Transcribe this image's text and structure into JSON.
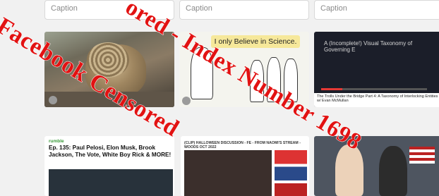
{
  "captions": [
    "Caption",
    "Caption",
    "Caption"
  ],
  "cartoon_bubble": "I only Believe in Science.",
  "taxonomy_title": "A (Incomplete!) Visual Taxonomy of Governing E",
  "taxonomy_footer": "The Trolls Under the Bridge Part 4: A Taxonomy of Interlocking Entities w/ Evan McMullan",
  "rumble_header": "rumble",
  "rumble_title": "Ep. 135: Paul Pelosi, Elon Musk, Brook Jackson, The Vote, White Boy Rick & MORE!",
  "yt_title": "(CLIP) HALLOWEEN DISCUSSION - FE - FROM NAOMI'S STREAM - WOODS OCT 2022",
  "watermark": {
    "line1": "Facebook Censored",
    "line2": "ored - Index Number 1698"
  },
  "colors": {
    "watermark": "#e21212",
    "rumble_green": "#3a9a3a",
    "bubble": "#f6e89a"
  }
}
